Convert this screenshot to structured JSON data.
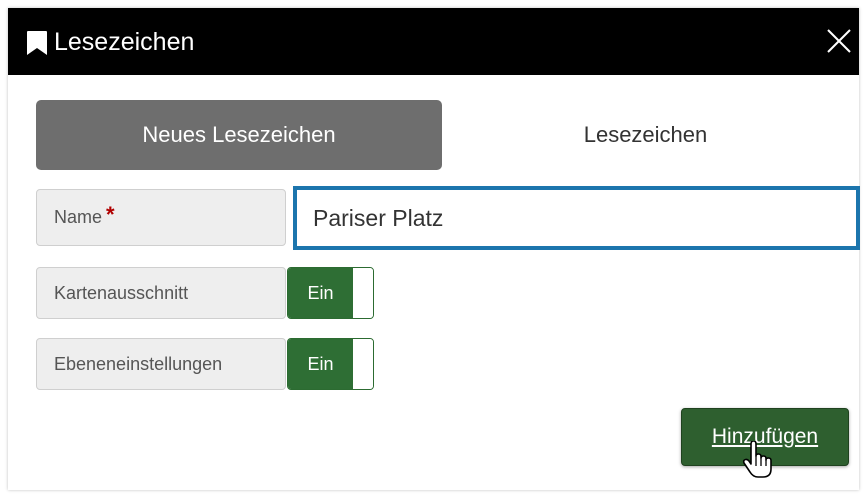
{
  "dialog": {
    "title": "Lesezeichen",
    "title_icon": "bookmark-icon",
    "close_icon": "close-icon"
  },
  "tabs": [
    {
      "label": "Neues Lesezeichen",
      "active": true
    },
    {
      "label": "Lesezeichen",
      "active": false
    }
  ],
  "form": {
    "name": {
      "label": "Name",
      "required_mark": "*",
      "value": "Pariser Platz"
    },
    "kartenausschnitt": {
      "label": "Kartenausschnitt",
      "toggle_label": "Ein"
    },
    "ebeneneinstellungen": {
      "label": "Ebeneneinstellungen",
      "toggle_label": "Ein"
    }
  },
  "actions": {
    "add_label": "Hinzufügen"
  },
  "colors": {
    "titlebar": "#000000",
    "active_tab": "#6e6e6e",
    "input_focus_border": "#1c75ad",
    "toggle_on": "#2e6e34",
    "add_button": "#2e5f2f",
    "required": "#b00000"
  },
  "cursor_icon": "hand-pointer-icon"
}
